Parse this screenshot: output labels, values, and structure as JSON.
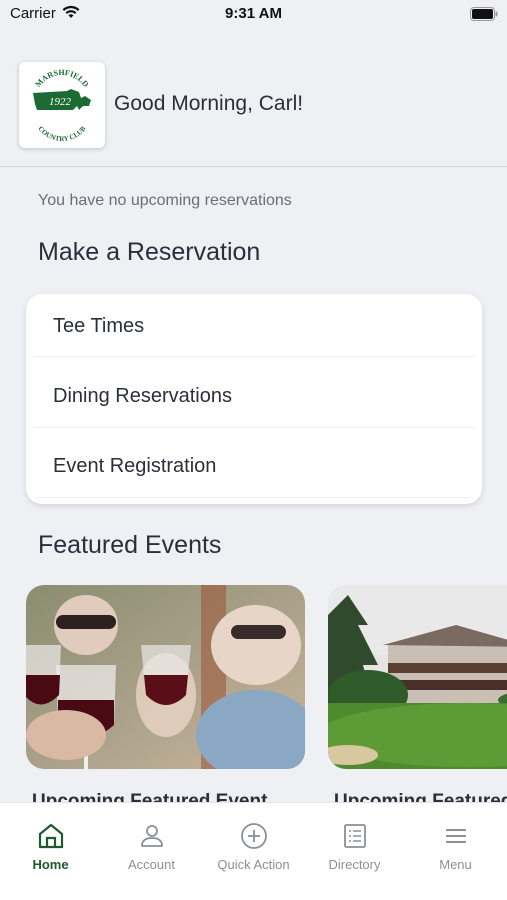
{
  "status_bar": {
    "carrier": "Carrier",
    "time": "9:31 AM",
    "icons": [
      "wifi-icon",
      "battery-icon"
    ]
  },
  "header": {
    "logo": {
      "text_top": "MARSHFIELD",
      "year": "1922",
      "text_bottom": "COUNTRY CLUB",
      "brand_color": "#1d6b34"
    },
    "greeting": "Good Morning, Carl!"
  },
  "reservations": {
    "none_message": "You have no upcoming reservations",
    "section_title": "Make a Reservation",
    "items": [
      {
        "label": "Tee Times"
      },
      {
        "label": "Dining Reservations"
      },
      {
        "label": "Event Registration"
      }
    ]
  },
  "featured": {
    "section_title": "Featured Events",
    "events": [
      {
        "title": "Upcoming Featured Event",
        "image": "wine-glasses-toast-photo"
      },
      {
        "title": "Upcoming Featured Event",
        "image": "clubhouse-golf-course-photo"
      }
    ]
  },
  "tabbar": {
    "active_color": "#1d5a2c",
    "inactive_color": "#8c8f96",
    "tabs": [
      {
        "label": "Home",
        "icon": "home-icon",
        "active": true
      },
      {
        "label": "Account",
        "icon": "person-icon",
        "active": false
      },
      {
        "label": "Quick Action",
        "icon": "plus-circle-icon",
        "active": false
      },
      {
        "label": "Directory",
        "icon": "list-book-icon",
        "active": false
      },
      {
        "label": "Menu",
        "icon": "hamburger-icon",
        "active": false
      }
    ]
  }
}
